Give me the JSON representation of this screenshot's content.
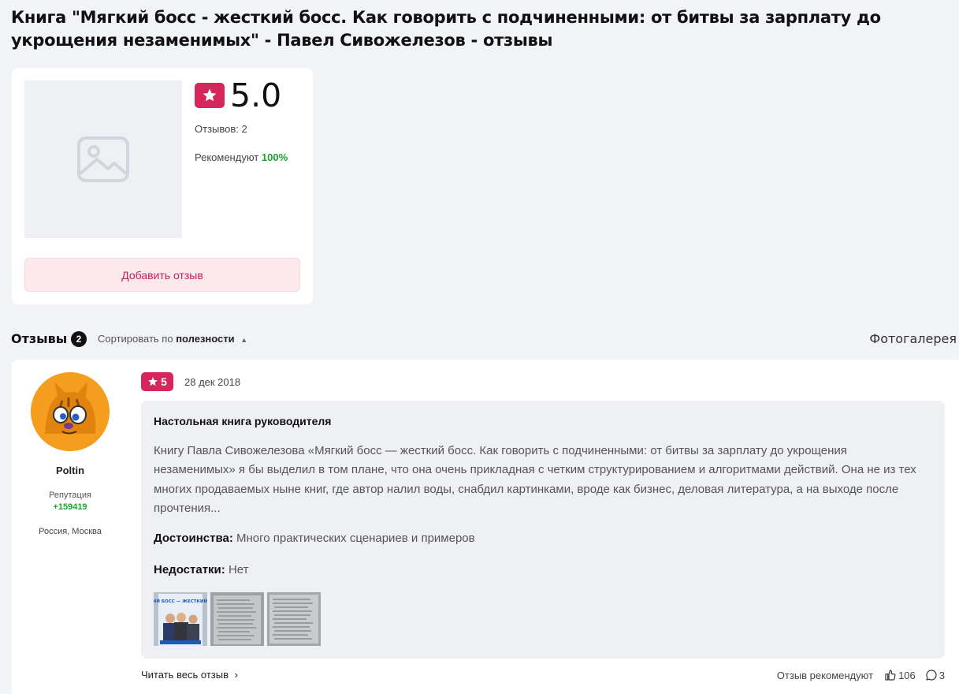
{
  "page": {
    "title": "Книга \"Мягкий босс - жесткий босс. Как говорить с подчиненными: от битвы за зарплату до укрощения незаменимых\" - Павел Сивожелезов - отзывы"
  },
  "summary": {
    "rating": "5.0",
    "reviews_count": "Отзывов: 2",
    "recommend_label": "Рекомендуют",
    "recommend_pct": "100%",
    "add_review": "Добавить отзыв"
  },
  "reviews_bar": {
    "title": "Отзывы",
    "count": "2",
    "sort_prefix": "Сортировать по",
    "sort_value": "полезности",
    "gallery": "Фотогалерея"
  },
  "review": {
    "username": "Poltin",
    "reputation_label": "Репутация",
    "reputation_value": "+159419",
    "location": "Россия, Москва",
    "rating": "5",
    "date": "28 дек 2018",
    "title": "Настольная книга руководителя",
    "text": "Книгу Павла Сивожелезова «Мягкий босс — жесткий босс. Как говорить с подчиненными: от битвы за зарплату до укрощения незаменимых» я бы выделил в том плане, что она очень прикладная с четким структурированием и алгоритмами действий. Она не из тех многих продаваемых ныне книг, где автор налил воды, снабдил картинками, вроде как бизнес, деловая литература, а на выходе после прочтения...",
    "pros_label": "Достоинства:",
    "pros": "Много практических сценариев и примеров",
    "cons_label": "Недостатки:",
    "cons": "Нет",
    "read_more": "Читать весь отзыв",
    "recommends": "Отзыв рекомендуют",
    "likes": "106",
    "comments": "3",
    "cover_thumb_title": "МЯГКИЙ БОСС — ЖЕСТКИЙ БОСС"
  },
  "colors": {
    "accent": "#d6275c",
    "green": "#1ea232",
    "background": "#f2f3f7"
  }
}
